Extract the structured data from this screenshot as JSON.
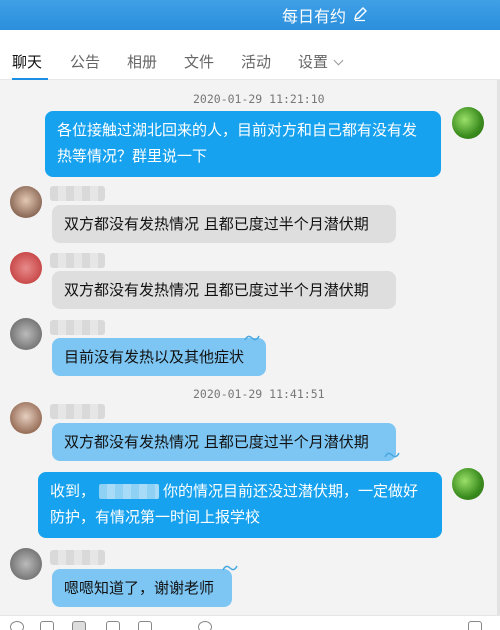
{
  "window": {
    "title": "每日有约",
    "edit_icon": "pencil-icon"
  },
  "tabs": [
    {
      "label": "聊天",
      "active": true
    },
    {
      "label": "公告",
      "active": false
    },
    {
      "label": "相册",
      "active": false
    },
    {
      "label": "文件",
      "active": false
    },
    {
      "label": "活动",
      "active": false
    },
    {
      "label": "设置",
      "active": false,
      "dropdown": true
    }
  ],
  "colors": {
    "title_bar": "#2b8fdc",
    "my_bubble": "#16a2ee",
    "received_bubble": "#dedede",
    "highlight_bubble": "#7dc6f3"
  },
  "messages": {
    "ts1": "2020-01-29 11:21:10",
    "m1": "各位接触过湖北回来的人，目前对方和自己都有没有发热等情况？群里说一下",
    "m2": "双方都没有发热情况  且都已度过半个月潜伏期",
    "m3": "双方都没有发热情况  且都已度过半个月潜伏期",
    "m4": "目前没有发热以及其他症状",
    "ts2": "2020-01-29 11:41:51",
    "m5": "双方都没有发热情况  且都已度过半个月潜伏期",
    "m6_prefix": "收到，",
    "m6_suffix": "你的情况目前还没过潜伏期，一定做好防护，有情况第一时间上报学校",
    "m7": "嗯嗯知道了，谢谢老师"
  }
}
